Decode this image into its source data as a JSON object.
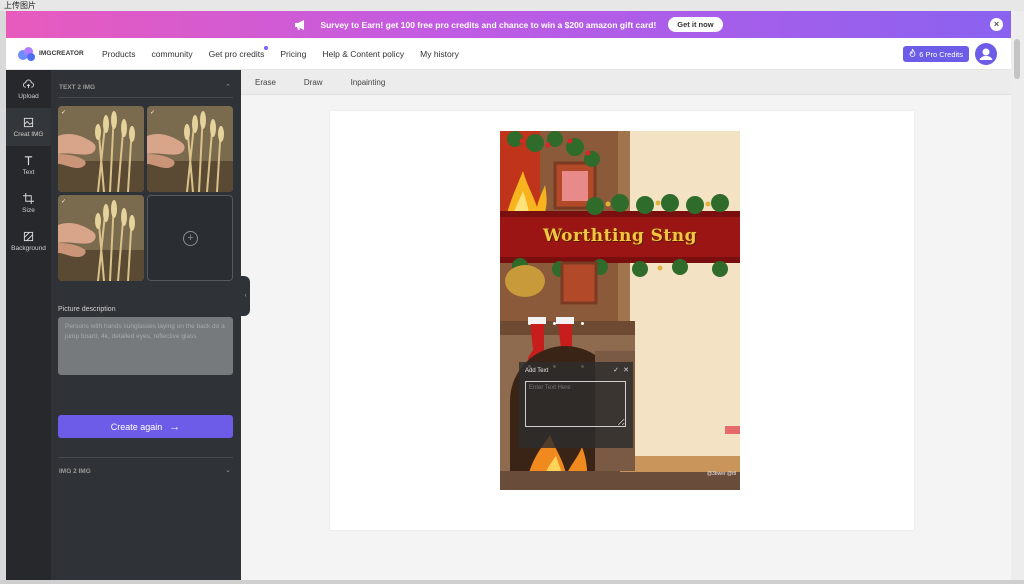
{
  "window": {
    "title": "上传图片"
  },
  "banner": {
    "text": "Survey to Earn! get 100 free pro credits and chance to win a $200 amazon gift card!",
    "cta": "Get it now",
    "close": "×"
  },
  "nav": {
    "logo": "IMGCREATOR",
    "items": [
      "Products",
      "community",
      "Get pro credits",
      "Pricing",
      "Help & Content policy",
      "My history"
    ],
    "credits": "6 Pro Credits"
  },
  "rail": {
    "items": [
      {
        "label": "Upload",
        "icon": "upload-icon"
      },
      {
        "label": "Creat IMG",
        "icon": "image-icon"
      },
      {
        "label": "Text",
        "icon": "text-icon"
      },
      {
        "label": "Size",
        "icon": "crop-icon"
      },
      {
        "label": "Background",
        "icon": "background-icon"
      }
    ]
  },
  "panel": {
    "section1": "TEXT 2 IMG",
    "section2": "IMG 2 IMG",
    "desc_label": "Picture description",
    "desc_text": "Persons with hands sunglasses laying on the back do a jump board, 4k, detailed eyes, reflective glass",
    "create_button": "Create again",
    "create_arrow": "→",
    "chev1": "⌃",
    "chev2": "⌄",
    "collapse": "‹"
  },
  "toolbar": {
    "items": [
      "Erase",
      "Draw",
      "Inpainting"
    ]
  },
  "poster": {
    "title": "Worthting Stng",
    "signature": "@3bwer @ttl"
  },
  "add_text": {
    "label": "Add Text",
    "ok": "✓",
    "close": "✕",
    "placeholder": "Enter Text Here"
  },
  "colors": {
    "accent": "#6c5ce7",
    "rail_bg": "#26282b",
    "panel_bg": "#2f3236",
    "banner_start": "#e85bbd",
    "banner_end": "#8a62f0"
  }
}
